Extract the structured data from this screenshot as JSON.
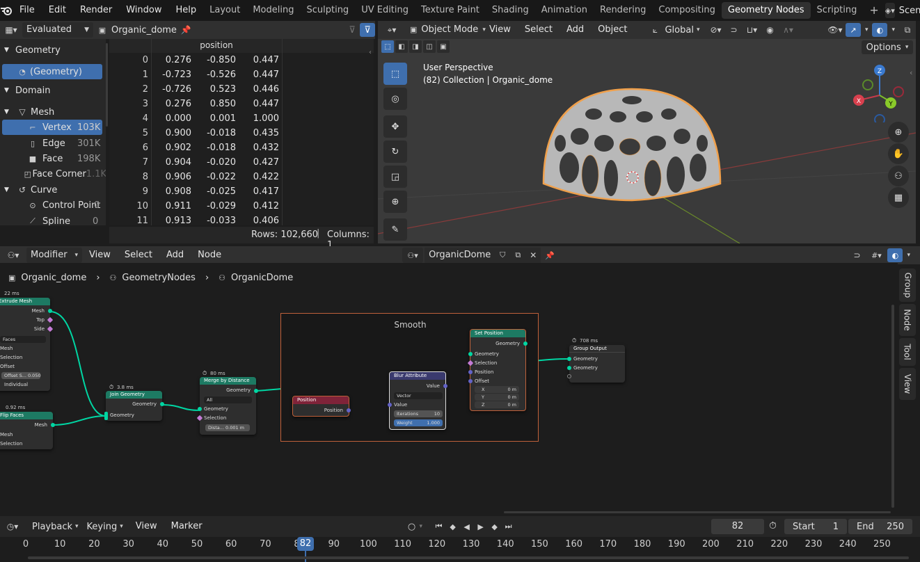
{
  "topbar": {
    "menus": [
      "File",
      "Edit",
      "Render",
      "Window",
      "Help"
    ],
    "workspaces": [
      "Layout",
      "Modeling",
      "Sculpting",
      "UV Editing",
      "Texture Paint",
      "Shading",
      "Animation",
      "Rendering",
      "Compositing",
      "Geometry Nodes",
      "Scripting"
    ],
    "active_workspace": "Geometry Nodes",
    "add_tab": "+",
    "scene": "Scene"
  },
  "spreadsheet": {
    "mode": "Evaluated",
    "object": "Organic_dome",
    "column_header": "position",
    "tree": {
      "geometry_label": "Geometry",
      "geometry_item": "(Geometry)",
      "domain_label": "Domain",
      "mesh_label": "Mesh",
      "mesh_domains": [
        {
          "name": "Vertex",
          "count": "103K"
        },
        {
          "name": "Edge",
          "count": "301K"
        },
        {
          "name": "Face",
          "count": "198K"
        },
        {
          "name": "Face Corner",
          "count": "1.1K"
        }
      ],
      "curve_label": "Curve",
      "curve_domains": [
        {
          "name": "Control Point",
          "count": "0"
        },
        {
          "name": "Spline",
          "count": "0"
        }
      ]
    },
    "rows": [
      [
        "0",
        "0.276",
        "-0.850",
        "0.447"
      ],
      [
        "1",
        "-0.723",
        "-0.526",
        "0.447"
      ],
      [
        "2",
        "-0.726",
        "0.523",
        "0.446"
      ],
      [
        "3",
        "0.276",
        "0.850",
        "0.447"
      ],
      [
        "4",
        "0.000",
        "0.001",
        "1.000"
      ],
      [
        "5",
        "0.900",
        "-0.018",
        "0.435"
      ],
      [
        "6",
        "0.902",
        "-0.018",
        "0.432"
      ],
      [
        "7",
        "0.904",
        "-0.020",
        "0.427"
      ],
      [
        "8",
        "0.906",
        "-0.022",
        "0.422"
      ],
      [
        "9",
        "0.908",
        "-0.025",
        "0.417"
      ],
      [
        "10",
        "0.911",
        "-0.029",
        "0.412"
      ],
      [
        "11",
        "0.913",
        "-0.033",
        "0.406"
      ]
    ],
    "rows_count": "Rows: 102,660",
    "columns_count": "Columns: 1"
  },
  "viewport": {
    "mode": "Object Mode",
    "menus": [
      "View",
      "Select",
      "Add",
      "Object"
    ],
    "orientation": "Global",
    "options": "Options",
    "perspective": "User Perspective",
    "collection_info": "(82) Collection | Organic_dome",
    "gizmo": {
      "z": "Z",
      "x": "X",
      "y": "Y"
    }
  },
  "node_editor": {
    "editor_type": "Modifier",
    "menus": [
      "View",
      "Select",
      "Add",
      "Node"
    ],
    "node_group": "OrganicDome",
    "breadcrumb": [
      "Organic_dome",
      "GeometryNodes",
      "OrganicDome"
    ],
    "side_tabs": [
      "Group",
      "Node",
      "Tool",
      "View"
    ],
    "frame_label": "Smooth",
    "nodes": {
      "extrude": {
        "time": "22 ms",
        "title": "Extrude Mesh",
        "out_mesh": "Mesh",
        "out_top": "Top",
        "out_side": "Side",
        "mode": "Faces",
        "in_mesh": "Mesh",
        "in_selection": "Selection",
        "in_offset": "Offset",
        "offset_scale": "Offset S...  0.050",
        "individual": "Individual"
      },
      "flip": {
        "time": "0.92 ms",
        "title": "Flip Faces",
        "out_mesh": "Mesh",
        "in_mesh": "Mesh",
        "in_selection": "Selection"
      },
      "join": {
        "time": "3.8 ms",
        "title": "Join Geometry",
        "out_geometry": "Geometry",
        "in_geometry": "Geometry"
      },
      "merge": {
        "time": "80 ms",
        "title": "Merge by Distance",
        "out_geometry": "Geometry",
        "mode": "All",
        "in_geometry": "Geometry",
        "in_selection": "Selection",
        "distance": "Dista...  0.001 m"
      },
      "position": {
        "title": "Position",
        "out_position": "Position"
      },
      "blur": {
        "title": "Blur Attribute",
        "out_value": "Value",
        "type": "Vector",
        "in_value": "Value",
        "iterations_label": "Iterations",
        "iterations": "10",
        "weight_label": "Weight",
        "weight": "1.000"
      },
      "setpos": {
        "title": "Set Position",
        "out_geometry": "Geometry",
        "in_geometry": "Geometry",
        "in_selection": "Selection",
        "in_position": "Position",
        "in_offset": "Offset",
        "x_label": "X",
        "x": "0 m",
        "y_label": "Y",
        "y": "0 m",
        "z_label": "Z",
        "z": "0 m"
      },
      "output": {
        "time": "708 ms",
        "title": "Group Output",
        "in_geometry1": "Geometry",
        "in_geometry2": "Geometry"
      }
    }
  },
  "timeline": {
    "menus": [
      "Playback",
      "Keying",
      "View",
      "Marker"
    ],
    "current_frame": "82",
    "start_label": "Start",
    "start": "1",
    "end_label": "End",
    "end": "250",
    "ticks": [
      "0",
      "10",
      "20",
      "30",
      "40",
      "50",
      "60",
      "70",
      "80",
      "90",
      "100",
      "110",
      "120",
      "130",
      "140",
      "150",
      "160",
      "170",
      "180",
      "190",
      "200",
      "210",
      "220",
      "230",
      "240",
      "250"
    ]
  },
  "colors": {
    "accent": "#3f6fae",
    "geometry_node": "#1d7a63",
    "input_node": "#7f2339",
    "vector_node": "#3a3a6e",
    "selection_orange": "#f0a04b",
    "geometry_socket": "#00d6a3",
    "vector_socket": "#6363c7",
    "frame_border": "#c0613a"
  }
}
